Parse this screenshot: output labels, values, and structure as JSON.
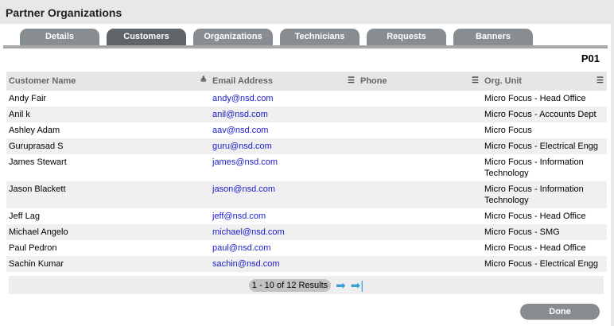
{
  "title": "Partner Organizations",
  "tabs": [
    "Details",
    "Customers",
    "Organizations",
    "Technicians",
    "Requests",
    "Banners"
  ],
  "active_tab": "Customers",
  "org_code": "P01",
  "columns": [
    "Customer Name",
    "Email Address",
    "Phone",
    "Org. Unit"
  ],
  "rows": [
    {
      "name": "Andy Fair",
      "email": "andy@nsd.com",
      "phone": "",
      "org": "Micro Focus - Head Office"
    },
    {
      "name": "Anil k",
      "email": "anil@nsd.com",
      "phone": "",
      "org": "Micro Focus - Accounts Dept"
    },
    {
      "name": "Ashley Adam",
      "email": "aav@nsd.com",
      "phone": "",
      "org": "Micro Focus"
    },
    {
      "name": "Guruprasad S",
      "email": "guru@nsd.com",
      "phone": "",
      "org": "Micro Focus - Electrical Engg"
    },
    {
      "name": "James Stewart",
      "email": "james@nsd.com",
      "phone": "",
      "org": "Micro Focus - Information Technology"
    },
    {
      "name": "Jason Blackett",
      "email": "jason@nsd.com",
      "phone": "",
      "org": "Micro Focus - Information Technology"
    },
    {
      "name": "Jeff Lag",
      "email": "jeff@nsd.com",
      "phone": "",
      "org": "Micro Focus - Head Office"
    },
    {
      "name": "Michael Angelo",
      "email": "michael@nsd.com",
      "phone": "",
      "org": "Micro Focus - SMG"
    },
    {
      "name": "Paul Pedron",
      "email": "paul@nsd.com",
      "phone": "",
      "org": "Micro Focus - Head Office"
    },
    {
      "name": "Sachin Kumar",
      "email": "sachin@nsd.com",
      "phone": "",
      "org": "Micro Focus - Electrical Engg"
    }
  ],
  "pagination": {
    "summary": "1 - 10 of 12 Results",
    "next_icon": "arrow-right",
    "last_icon": "arrow-last"
  },
  "done_label": "Done"
}
